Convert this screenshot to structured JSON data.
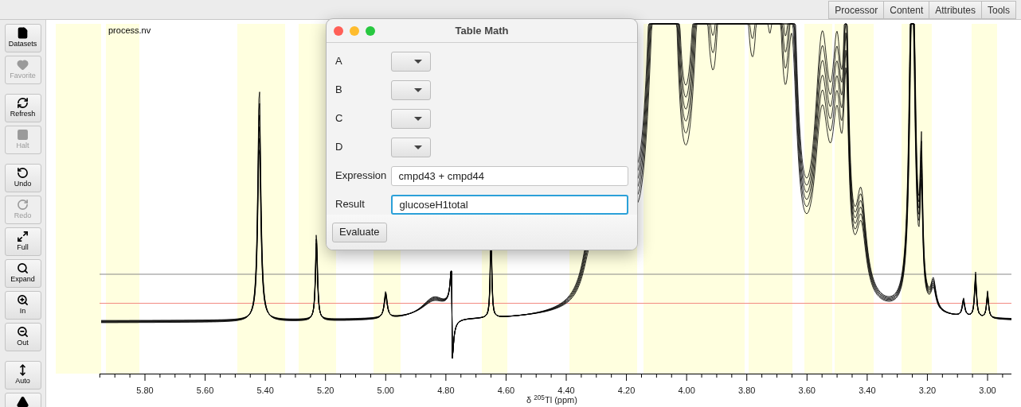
{
  "top_tabs": [
    {
      "label": "Processor"
    },
    {
      "label": "Content"
    },
    {
      "label": "Attributes"
    },
    {
      "label": "Tools"
    }
  ],
  "toolbar": [
    {
      "kind": "button",
      "label": "Datasets",
      "disabled": false
    },
    {
      "kind": "button",
      "label": "Favorite",
      "disabled": true
    },
    {
      "kind": "separator"
    },
    {
      "kind": "button",
      "label": "Refresh",
      "disabled": false
    },
    {
      "kind": "button",
      "label": "Halt",
      "disabled": true
    },
    {
      "kind": "separator"
    },
    {
      "kind": "button",
      "label": "Undo",
      "disabled": false
    },
    {
      "kind": "button",
      "label": "Redo",
      "disabled": true
    },
    {
      "kind": "button",
      "label": "Full",
      "disabled": false
    },
    {
      "kind": "button",
      "label": "Expand",
      "disabled": false
    },
    {
      "kind": "button",
      "label": "In",
      "disabled": false
    },
    {
      "kind": "button",
      "label": "Out",
      "disabled": false
    },
    {
      "kind": "separator"
    },
    {
      "kind": "button",
      "label": "Auto",
      "disabled": false
    },
    {
      "kind": "button",
      "disabled": false
    }
  ],
  "plot": {
    "dataset": "process.nv",
    "x_ticks": [
      "5.80",
      "5.60",
      "5.40",
      "5.20",
      "5.00",
      "4.80",
      "4.60",
      "4.40",
      "4.20",
      "4.00",
      "3.80",
      "3.60",
      "3.40",
      "3.20",
      "3.00"
    ],
    "x_label": "δ $^{205}$Tl (ppm)"
  },
  "dialog": {
    "title": "Table Math",
    "fields": [
      {
        "label": "A",
        "kind": "combo"
      },
      {
        "label": "B",
        "kind": "combo"
      },
      {
        "label": "C",
        "kind": "combo"
      },
      {
        "label": "D",
        "kind": "combo"
      },
      {
        "label": "Expression",
        "kind": "text",
        "value": "cmpd43 + cmpd44",
        "focused": false
      },
      {
        "label": "Result",
        "kind": "text",
        "value": "glucoseH1total",
        "focused": true
      }
    ],
    "buttons": [
      "Evaluate"
    ]
  }
}
